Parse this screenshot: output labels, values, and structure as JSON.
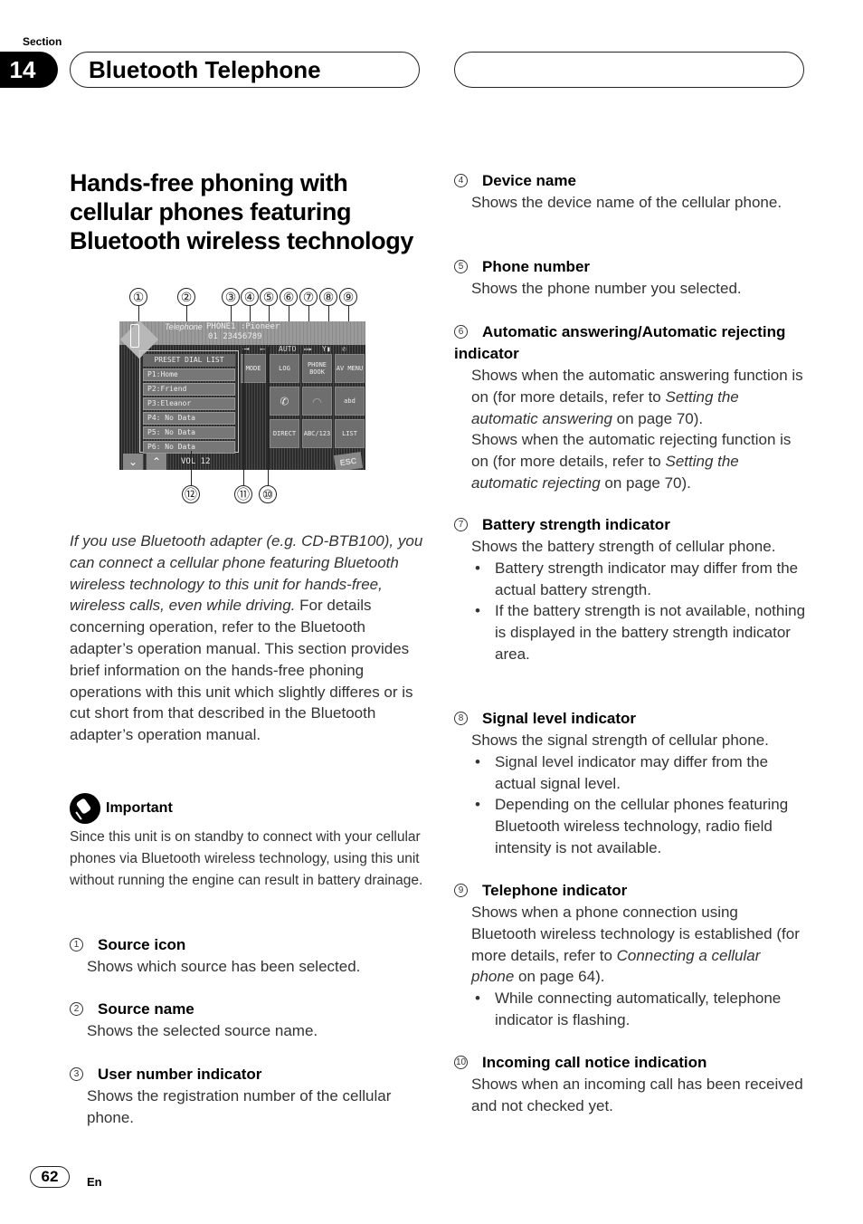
{
  "header": {
    "section_label": "Section",
    "section_number": "14",
    "section_title": "Bluetooth Telephone"
  },
  "title": "Hands-free phoning with cellular phones featuring Bluetooth wireless technology",
  "figure": {
    "callouts_top": [
      "①",
      "②",
      "③",
      "④",
      "⑤",
      "⑥",
      "⑦",
      "⑧",
      "⑨"
    ],
    "callouts_bottom": [
      "⑫",
      "⑪",
      "⑩"
    ],
    "screen": {
      "source_name": "Telephone",
      "user_device": "PHONE1 :Pioneer",
      "phone_number": "01 23456789",
      "auto_indicator": "AUTO",
      "preset_header": "PRESET DIAL LIST",
      "presets": [
        "P1:Home",
        "P2:Friend",
        "P3:Eleanor",
        "P4:  No Data",
        "P5:  No Data",
        "P6:  No Data"
      ],
      "buttons": [
        "MODE",
        "LOG",
        "PHONE BOOK",
        "AV MENU",
        "",
        "",
        "abd",
        "DIRECT",
        "ABC/123",
        "LIST"
      ],
      "volume": "VOL 12",
      "esc": "ESC",
      "down_arrow": "⌄",
      "up_arrow": "⌃"
    }
  },
  "intro": {
    "italic": "If you use Bluetooth adapter (e.g. CD-BTB100), you can connect a cellular phone featuring Bluetooth wireless technology to this unit for hands-free, wireless calls, even while driving.",
    "normal": "For details concerning operation, refer to the Bluetooth adapter’s operation manual. This section provides brief information on the hands-free phoning operations with this unit which slightly differes or is cut short from that described in the Bluetooth adapter’s operation manual."
  },
  "important": {
    "label": "Important",
    "text": "Since this unit is on standby to connect with your cellular phones via Bluetooth wireless technology, using this unit without running the engine can result in battery drainage."
  },
  "items": [
    {
      "num": "1",
      "title": "Source icon",
      "body": "Shows which source has been selected."
    },
    {
      "num": "2",
      "title": "Source name",
      "body": "Shows the selected source name."
    },
    {
      "num": "3",
      "title": "User number indicator",
      "body": "Shows the registration number of the cellular phone."
    },
    {
      "num": "4",
      "title": "Device name",
      "body": "Shows the device name of the cellular phone."
    },
    {
      "num": "5",
      "title": "Phone number",
      "body": "Shows the phone number you selected."
    },
    {
      "num": "6",
      "title": "Automatic answering/Automatic rejecting indicator",
      "body1_a": "Shows when the automatic answering function is on (for more details, refer to ",
      "body1_link": "Setting the automatic answering",
      "body1_b": " on page 70).",
      "body2_a": "Shows when the automatic rejecting function is on (for more details, refer to ",
      "body2_link": "Setting the automatic rejecting",
      "body2_b": " on page 70)."
    },
    {
      "num": "7",
      "title": "Battery strength indicator",
      "body": "Shows the battery strength of cellular phone.",
      "bullets": [
        "Battery strength indicator may differ from the actual battery strength.",
        "If the battery strength is not available, nothing is displayed in the battery strength indicator area."
      ]
    },
    {
      "num": "8",
      "title": "Signal level indicator",
      "body": "Shows the signal strength of cellular phone.",
      "bullets": [
        "Signal level indicator may differ from the actual signal level.",
        "Depending on the cellular phones featuring Bluetooth wireless technology, radio field intensity is not available."
      ]
    },
    {
      "num": "9",
      "title": "Telephone indicator",
      "body_a": "Shows when a phone connection using Bluetooth wireless technology is established (for more details, refer to ",
      "body_link": "Connecting a cellular phone",
      "body_b": " on page 64).",
      "bullets": [
        "While connecting automatically, telephone indicator is flashing."
      ]
    },
    {
      "num": "10",
      "title": "Incoming call notice indication",
      "body": "Shows when an incoming call has been received and not checked yet."
    }
  ],
  "footer": {
    "page_number": "62",
    "language": "En"
  }
}
